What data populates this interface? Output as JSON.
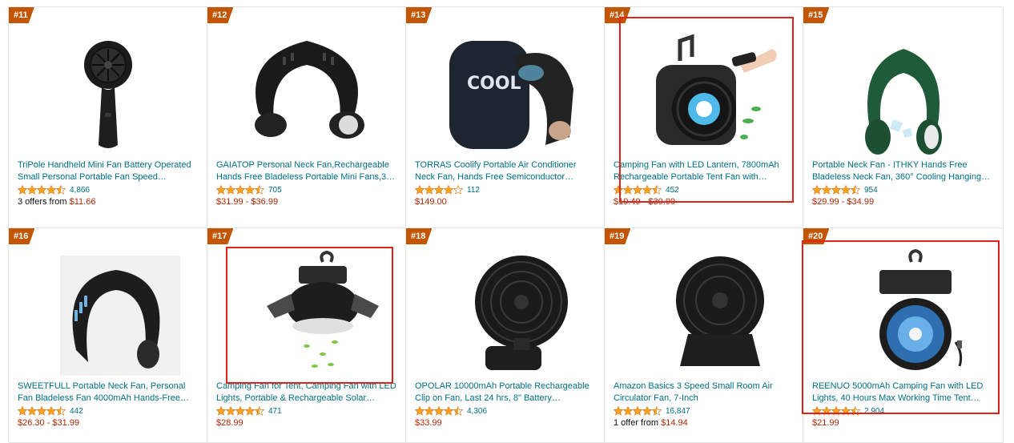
{
  "products": [
    {
      "rank": "#11",
      "title": "TriPole Handheld Mini Fan Battery Operated Small Personal Portable Fan Speed…",
      "stars": 4.5,
      "reviews": "4,866",
      "price_prefix": "3 offers from ",
      "price": "$11.66",
      "icon": "handheld-fan"
    },
    {
      "rank": "#12",
      "title": "GAIATOP Personal Neck Fan,Rechargeable Hands Free Bladeless Portable Mini Fans,3…",
      "stars": 4.5,
      "reviews": "705",
      "price_prefix": "",
      "price": "$31.99 - $36.99",
      "icon": "neck-fan-black"
    },
    {
      "rank": "#13",
      "title": "TORRAS Coolify Portable Air Conditioner Neck Fan, Hands Free Semiconductor Cooling…",
      "stars": 4.0,
      "reviews": "112",
      "price_prefix": "",
      "price": "$149.00",
      "icon": "neck-fan-cooler"
    },
    {
      "rank": "#14",
      "title": "Camping Fan with LED Lantern, 7800mAh Rechargeable Portable Tent Fan with Remote…",
      "stars": 4.5,
      "reviews": "452",
      "price_prefix": "",
      "price": "$19.49 - $30.99",
      "icon": "camping-fan-lantern"
    },
    {
      "rank": "#15",
      "title": "Portable Neck Fan - ITHKY Hands Free Bladeless Neck Fan, 360° Cooling Hanging…",
      "stars": 4.5,
      "reviews": "954",
      "price_prefix": "",
      "price": "$29.99 - $34.99",
      "icon": "neck-fan-green"
    },
    {
      "rank": "#16",
      "title": "SWEETFULL Portable Neck Fan, Personal Fan Bladeless Fan 4000mAh Hands-Free USB…",
      "stars": 4.5,
      "reviews": "442",
      "price_prefix": "",
      "price": "$26.30 - $31.99",
      "icon": "neck-fan-blue"
    },
    {
      "rank": "#17",
      "title": "Camping Fan for Tent, Camping Fan with LED Lights, Portable & Rechargeable Solar…",
      "stars": 4.5,
      "reviews": "471",
      "price_prefix": "",
      "price": "$28.99",
      "icon": "tent-fan-led"
    },
    {
      "rank": "#18",
      "title": "OPOLAR 10000mAh Portable Rechargeable Clip on Fan, Last 24 hrs, 8\" Battery Operated…",
      "stars": 4.5,
      "reviews": "4,306",
      "price_prefix": "",
      "price": "$33.99",
      "icon": "clip-fan"
    },
    {
      "rank": "#19",
      "title": "Amazon Basics 3 Speed Small Room Air Circulator Fan, 7-Inch",
      "stars": 4.5,
      "reviews": "16,847",
      "price_prefix": "1 offer from ",
      "price": "$14.94",
      "icon": "air-circulator-fan"
    },
    {
      "rank": "#20",
      "title": "REENUO 5000mAh Camping Fan with LED Lights, 40 Hours Max Working Time Tent Fan…",
      "stars": 4.5,
      "reviews": "2,904",
      "price_prefix": "",
      "price": "$21.99",
      "icon": "camping-fan-hook"
    }
  ],
  "colors": {
    "accent": "#c45500",
    "link": "#007185",
    "price": "#b12704",
    "star": "#ffa41c",
    "highlight": "#e2231a"
  }
}
